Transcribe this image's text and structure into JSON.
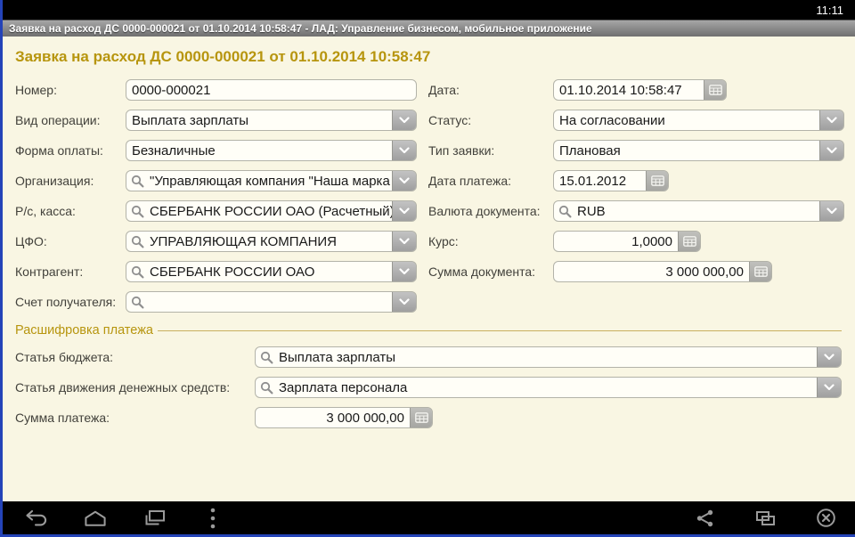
{
  "status_bar": {
    "time": "11:11"
  },
  "title_bar": {
    "title": "Заявка на расход ДС 0000-000021 от 01.10.2014 10:58:47 - ЛАД: Управление бизнесом, мобильное приложение"
  },
  "page": {
    "heading": "Заявка на расход ДС 0000-000021 от 01.10.2014 10:58:47",
    "section_header": "Расшифровка платежа"
  },
  "fields": {
    "nomer": {
      "label": "Номер:",
      "value": "0000-000021"
    },
    "data": {
      "label": "Дата:",
      "value": "01.10.2014 10:58:47"
    },
    "vid_operacii": {
      "label": "Вид операции:",
      "value": "Выплата зарплаты"
    },
    "status": {
      "label": "Статус:",
      "value": "На согласовании"
    },
    "forma_oplaty": {
      "label": "Форма оплаты:",
      "value": "Безналичные"
    },
    "tip_zayavki": {
      "label": "Тип заявки:",
      "value": "Плановая"
    },
    "organizaciya": {
      "label": "Организация:",
      "value": "\"Управляющая компания \"Наша марка"
    },
    "data_platezha": {
      "label": "Дата платежа:",
      "value": "15.01.2012"
    },
    "rs_kassa": {
      "label": "Р/с, касса:",
      "value": "СБЕРБАНК РОССИИ ОАО (Расчетный)"
    },
    "valyuta_dokumenta": {
      "label": "Валюта документа:",
      "value": "RUB"
    },
    "cfo": {
      "label": "ЦФО:",
      "value": "УПРАВЛЯЮЩАЯ КОМПАНИЯ"
    },
    "kurs": {
      "label": "Курс:",
      "value": "1,0000"
    },
    "kontragent": {
      "label": "Контрагент:",
      "value": "СБЕРБАНК РОССИИ ОАО"
    },
    "summa_dokumenta": {
      "label": "Сумма документа:",
      "value": "3 000 000,00"
    },
    "schet_poluchatelya": {
      "label": "Счет получателя:",
      "value": ""
    },
    "statya_byudzheta": {
      "label": "Статья бюджета:",
      "value": "Выплата зарплаты"
    },
    "statya_dvizheniya": {
      "label": "Статья движения денежных средств:",
      "value": "Зарплата персонала"
    },
    "summa_platezha": {
      "label": "Сумма платежа:",
      "value": "3 000 000,00"
    }
  },
  "icons": {
    "field_icons": [
      "search-magnifier",
      "chevron-down",
      "keypad-grid-picker"
    ],
    "nav_icons": [
      "back",
      "home",
      "recent-apps",
      "menu-overflow",
      "share",
      "float-window",
      "close"
    ]
  },
  "colors": {
    "accent_gold": "#b7950e",
    "background_cream": "#f9f6e3",
    "frame_blue": "#2443b8",
    "titlebar_gray": "#8a8a8a",
    "bar_black": "#000000"
  }
}
